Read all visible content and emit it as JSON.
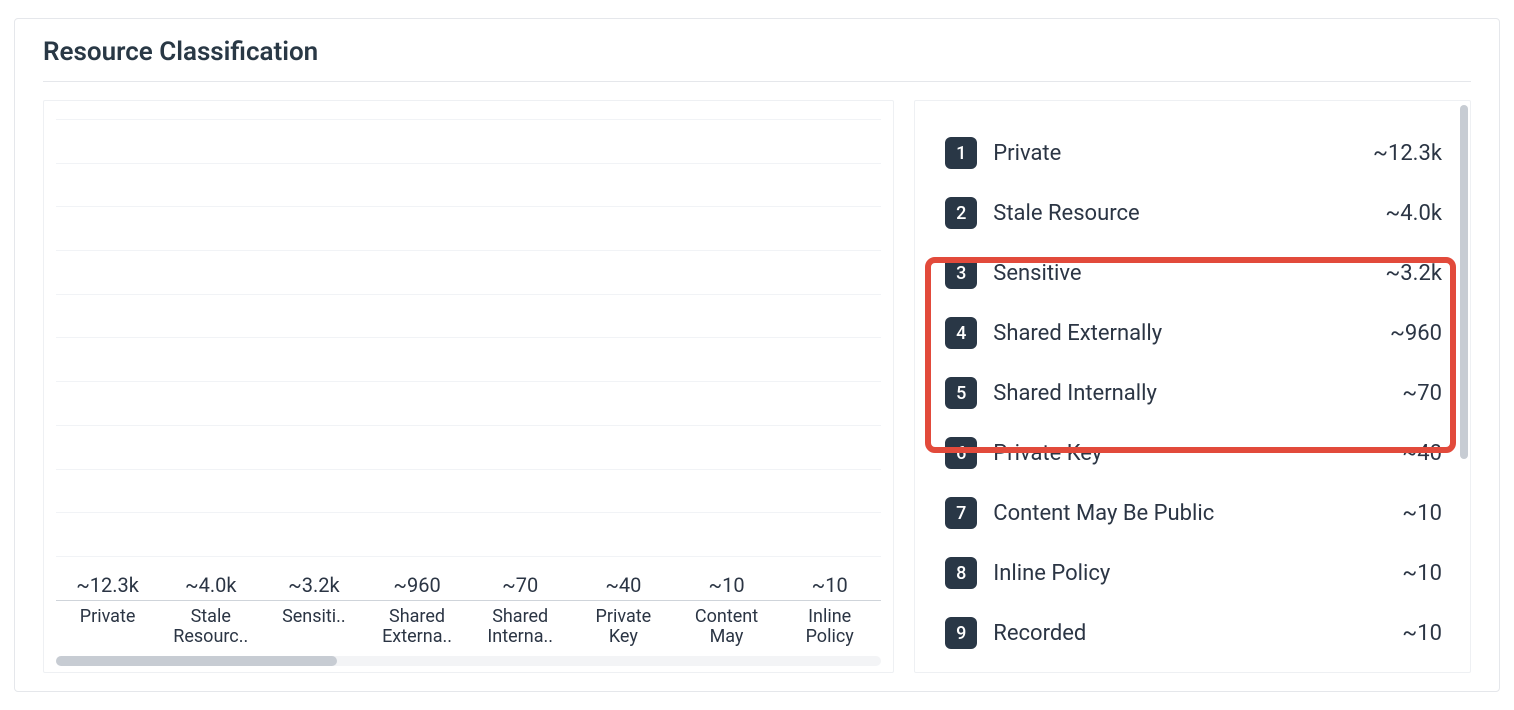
{
  "title": "Resource Classification",
  "chart_data": {
    "type": "bar",
    "title": "Resource Classification",
    "xlabel": "",
    "ylabel": "",
    "ylim": [
      0,
      12300
    ],
    "categories_full": [
      "Private",
      "Stale Resource",
      "Sensitive",
      "Shared Externally",
      "Shared Internally",
      "Private Key",
      "Content May Be Public",
      "Inline Policy",
      "Recorded"
    ],
    "categories_axis": [
      "Private",
      "Stale Resourc..",
      "Sensiti..",
      "Shared Externa..",
      "Shared Interna..",
      "Private Key",
      "Content May",
      "Inline Policy"
    ],
    "values": [
      12300,
      4000,
      3200,
      960,
      70,
      40,
      10,
      10,
      10
    ],
    "value_labels": [
      "~12.3k",
      "~4.0k",
      "~3.2k",
      "~960",
      "~70",
      "~40",
      "~10",
      "~10",
      "~10"
    ],
    "colors": [
      "#3b5499",
      "#b7bbd9",
      "#d84385",
      "#55b0b0",
      "#3d4e8e",
      "#7b7fc0",
      "#9ea2d2",
      "#c36a9c"
    ]
  },
  "list": [
    {
      "rank": "1",
      "label": "Private",
      "value": "~12.3k"
    },
    {
      "rank": "2",
      "label": "Stale Resource",
      "value": "~4.0k"
    },
    {
      "rank": "3",
      "label": "Sensitive",
      "value": "~3.2k"
    },
    {
      "rank": "4",
      "label": "Shared Externally",
      "value": "~960"
    },
    {
      "rank": "5",
      "label": "Shared Internally",
      "value": "~70"
    },
    {
      "rank": "6",
      "label": "Private Key",
      "value": "~40"
    },
    {
      "rank": "7",
      "label": "Content May Be Public",
      "value": "~10"
    },
    {
      "rank": "8",
      "label": "Inline Policy",
      "value": "~10"
    },
    {
      "rank": "9",
      "label": "Recorded",
      "value": "~10"
    }
  ],
  "highlight": {
    "start_index": 2,
    "end_index": 4
  }
}
